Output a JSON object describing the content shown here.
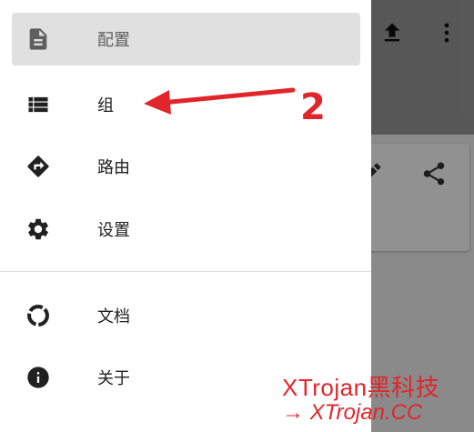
{
  "drawer": {
    "items": [
      {
        "label": "配置",
        "icon": "document-icon",
        "selected": true
      },
      {
        "label": "组",
        "icon": "list-icon",
        "selected": false
      },
      {
        "label": "路由",
        "icon": "route-icon",
        "selected": false
      },
      {
        "label": "设置",
        "icon": "gear-icon",
        "selected": false
      },
      {
        "label": "文档",
        "icon": "progress-ring-icon",
        "selected": false
      },
      {
        "label": "关于",
        "icon": "info-icon",
        "selected": false
      }
    ]
  },
  "app_bar": {
    "icons": [
      "upload-icon",
      "more-vert-icon"
    ]
  },
  "card": {
    "icons": [
      "edit-icon",
      "share-icon"
    ]
  },
  "annotation": {
    "number": "2",
    "color": "#e0262b"
  },
  "watermark": {
    "line1": "XTrojan黑科技",
    "line2": "→ XTrojan.CC"
  }
}
